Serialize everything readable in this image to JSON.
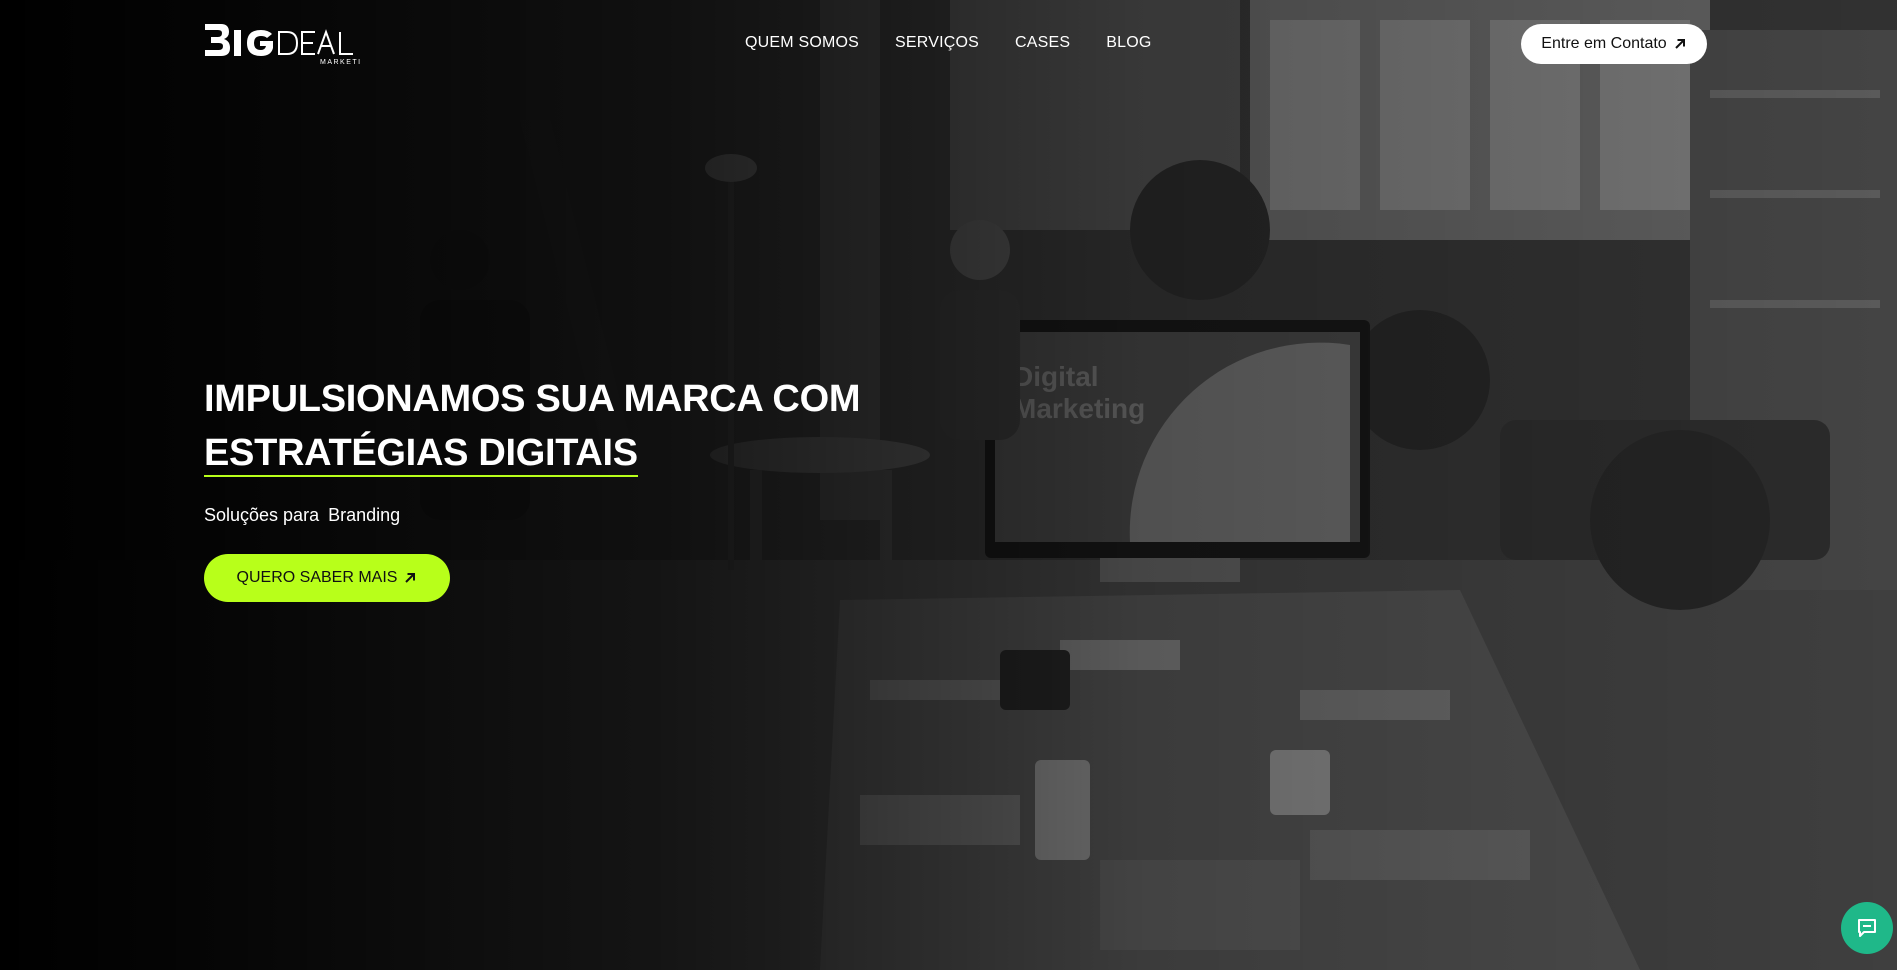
{
  "header": {
    "logo_text": "BIGDEAL",
    "logo_sub": "MARKETING",
    "nav": [
      {
        "label": "QUEM SOMOS"
      },
      {
        "label": "SERVIÇOS"
      },
      {
        "label": "CASES"
      },
      {
        "label": "BLOG"
      }
    ],
    "contact_label": "Entre em Contato"
  },
  "hero": {
    "headline_line1": "IMPULSIONAMOS SUA MARCA COM",
    "headline_line2": "ESTRATÉGIAS DIGITAIS",
    "subtitle_prefix": "Soluções para",
    "subtitle_word": "Branding",
    "cta_label": "QUERO SABER MAIS",
    "screen_text": "Digital Marketing"
  },
  "icons": {
    "arrow": "arrow-up-right-icon",
    "chat": "chat-icon"
  },
  "colors": {
    "accent": "#b8ff1a",
    "chat": "#1fb889",
    "contact_bg": "#ffffff"
  }
}
